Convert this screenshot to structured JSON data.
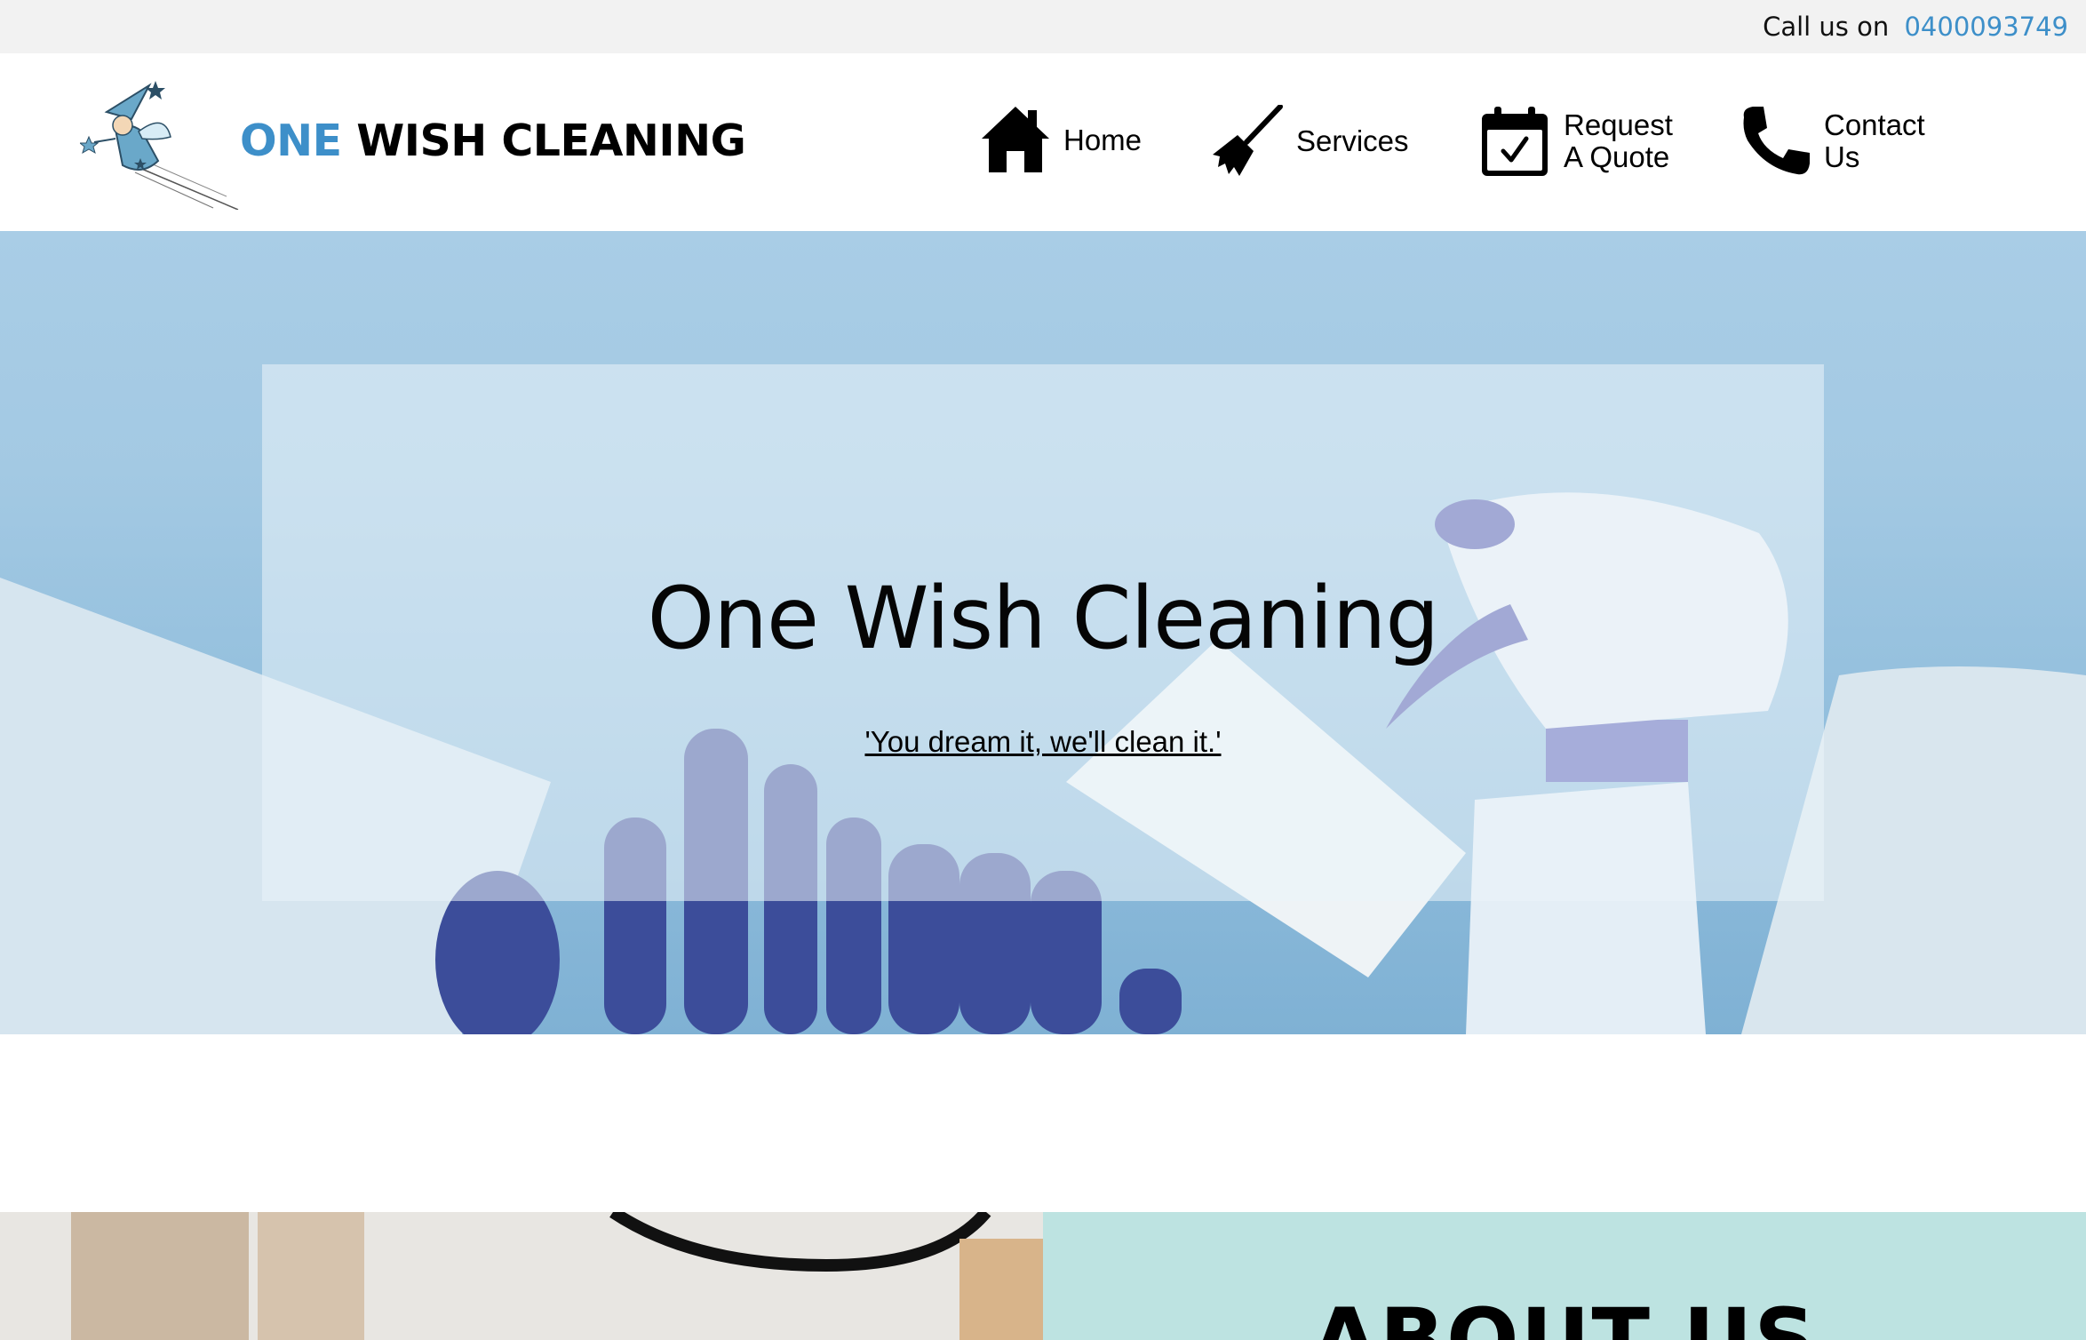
{
  "topbar": {
    "call_label": "Call us on",
    "phone": "0400093749"
  },
  "header": {
    "brand_first": "ONE",
    "brand_rest": " WISH CLEANING",
    "brand_colors": {
      "accent": "#3d8fc9",
      "dark": "#000000"
    },
    "logo_icon": "fairy-logo-icon"
  },
  "nav": {
    "home": {
      "label": "Home",
      "icon": "home-icon"
    },
    "services": {
      "label": "Services",
      "icon": "broom-icon"
    },
    "quote": {
      "label_line1": "Request",
      "label_line2": "A Quote",
      "icon": "calendar-check-icon"
    },
    "contact": {
      "label_line1": "Contact",
      "label_line2": "Us",
      "icon": "phone-icon"
    }
  },
  "hero": {
    "title": "One Wish Cleaning",
    "tagline": "'You dream it, we'll clean it.'"
  },
  "about": {
    "heading": "ABOUT US",
    "panel_color": "#bde3e1"
  }
}
